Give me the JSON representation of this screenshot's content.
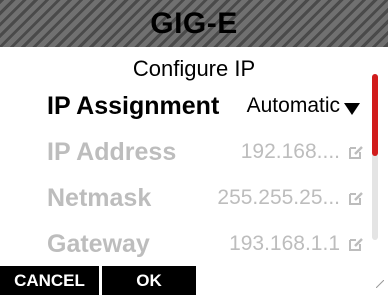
{
  "header": {
    "title": "GIG-E"
  },
  "screen": {
    "subtitle": "Configure IP"
  },
  "rows": [
    {
      "label": "IP Assignment",
      "value": "Automatic"
    },
    {
      "label": "IP Address",
      "value": "192.168...."
    },
    {
      "label": "Netmask",
      "value": "255.255.25..."
    },
    {
      "label": "Gateway",
      "value": "193.168.1.1"
    }
  ],
  "softkeys": {
    "cancel": "CANCEL",
    "ok": "OK"
  },
  "colors": {
    "accent": "#d11c1c",
    "disabled_text": "#bdbdbd",
    "header_dark": "#4a4a4a",
    "header_light": "#707070"
  },
  "icons": {
    "selection": "chevron-right-icon",
    "dropdown": "caret-down-icon",
    "edit": "edit-icon"
  },
  "scroll": {
    "position_fraction": 0.0,
    "visible_fraction": 0.5
  }
}
